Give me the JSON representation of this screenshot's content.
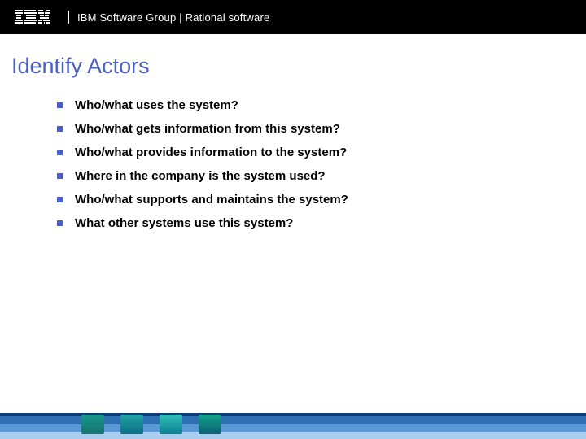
{
  "header": {
    "brand": "IBM",
    "group_text": "IBM Software Group | Rational software"
  },
  "slide": {
    "title": "Identify Actors",
    "bullets": [
      "Who/what uses the system?",
      "Who/what gets information from this system?",
      "Who/what provides information to the system?",
      "Where in the company is the system used?",
      "Who/what supports and maintains the system?",
      "What other systems use this system?"
    ]
  }
}
